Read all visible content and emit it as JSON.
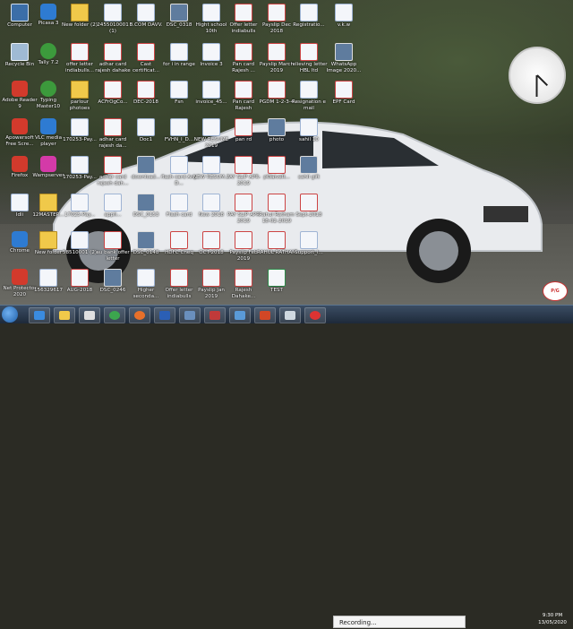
{
  "desktop": {
    "icons": [
      {
        "label": "Computer",
        "kind": "pc"
      },
      {
        "label": "Picasa 3",
        "kind": "app"
      },
      {
        "label": "New folder (2)",
        "kind": "folder"
      },
      {
        "label": "2455010001 (1)",
        "kind": "doc"
      },
      {
        "label": "B.COM DAVV.",
        "kind": "doc"
      },
      {
        "label": "DSC_0318",
        "kind": "img"
      },
      {
        "label": "Hight school 10th",
        "kind": "doc"
      },
      {
        "label": "Offer letter indiabulls",
        "kind": "pdf"
      },
      {
        "label": "Payslip Dec 2018",
        "kind": "pdf"
      },
      {
        "label": "Registratio...",
        "kind": "doc"
      },
      {
        "label": "v.k.w",
        "kind": "doc"
      },
      {
        "label": "Recycle Bin",
        "kind": "recycle"
      },
      {
        "label": "Tally 7.2",
        "kind": "green"
      },
      {
        "label": "offer letter indiabulls...",
        "kind": "pdf"
      },
      {
        "label": "adhar card rajesh dahake",
        "kind": "pdf"
      },
      {
        "label": "Cast certificat...",
        "kind": "pdf"
      },
      {
        "label": "for i in range",
        "kind": "doc"
      },
      {
        "label": "Invoice 3",
        "kind": "doc"
      },
      {
        "label": "Pan card Rajesh ...",
        "kind": "pdf"
      },
      {
        "label": "Payslip March 2019",
        "kind": "pdf"
      },
      {
        "label": "relieving letter HBL ltd",
        "kind": "pdf"
      },
      {
        "label": "WhatsApp Image 2020...",
        "kind": "img"
      },
      {
        "label": "Adobe Reader 9",
        "kind": "red"
      },
      {
        "label": "Typing Master10",
        "kind": "green"
      },
      {
        "label": "parlour photoes",
        "kind": "folder"
      },
      {
        "label": "ACFrOgCo...",
        "kind": "pdf"
      },
      {
        "label": "DEC-2018",
        "kind": "pdf"
      },
      {
        "label": "Fsn",
        "kind": "doc"
      },
      {
        "label": "invoice_45...",
        "kind": "doc"
      },
      {
        "label": "Pan card Rajesh",
        "kind": "pdf"
      },
      {
        "label": "PGDM 1-2-3-4",
        "kind": "pdf"
      },
      {
        "label": "Resignation e mail",
        "kind": "doc"
      },
      {
        "label": "EPF Card",
        "kind": "pdf"
      },
      {
        "label": "Apowersoft Free Scre...",
        "kind": "red"
      },
      {
        "label": "VLC media player",
        "kind": "app"
      },
      {
        "label": "170253-Pay...",
        "kind": "doc"
      },
      {
        "label": "adhar card rajesh da...",
        "kind": "pdf"
      },
      {
        "label": "Doc1",
        "kind": "doc"
      },
      {
        "label": "FVHN_I_D...",
        "kind": "doc"
      },
      {
        "label": "NEW RESUME 2019",
        "kind": "doc"
      },
      {
        "label": "pan rd",
        "kind": "pdf"
      },
      {
        "label": "photo",
        "kind": "img"
      },
      {
        "label": "sahil 10",
        "kind": "doc"
      },
      {
        "label": "Firefox",
        "kind": "red"
      },
      {
        "label": "Wamp­server",
        "kind": "pink"
      },
      {
        "label": "170253-Pay...",
        "kind": "doc"
      },
      {
        "label": "adhar card rajesh dah...",
        "kind": "pdf"
      },
      {
        "label": "download...",
        "kind": "img"
      },
      {
        "label": "flash card Any D...",
        "kind": "doc"
      },
      {
        "label": "NEW RESUM...",
        "kind": "doc"
      },
      {
        "label": "PAY SLIP APR-2019",
        "kind": "pdf"
      },
      {
        "label": "pWaiveR...",
        "kind": "pdf"
      },
      {
        "label": "sahil gift",
        "kind": "img"
      },
      {
        "label": "Idli",
        "kind": "doc"
      },
      {
        "label": "12MASTER...",
        "kind": "folder"
      },
      {
        "label": "17025-Pay...",
        "kind": "doc"
      },
      {
        "label": "appli...",
        "kind": "doc"
      },
      {
        "label": "DSC_0153",
        "kind": "img"
      },
      {
        "label": "Flash card",
        "kind": "doc"
      },
      {
        "label": "New 2018",
        "kind": "doc"
      },
      {
        "label": "PAY SLIP APR 2019",
        "kind": "pdf"
      },
      {
        "label": "Rahul Ratham 18-02-2019",
        "kind": "pdf"
      },
      {
        "label": "Sept-2018",
        "kind": "pdf"
      },
      {
        "label": "Chrome",
        "kind": "app"
      },
      {
        "label": "New folder",
        "kind": "folder"
      },
      {
        "label": "58510001 (2)",
        "kind": "doc"
      },
      {
        "label": "au bank offer letter",
        "kind": "pdf"
      },
      {
        "label": "DSC_0148",
        "kind": "img"
      },
      {
        "label": "HDFC Cheq",
        "kind": "pdf"
      },
      {
        "label": "OCT-2018",
        "kind": "pdf"
      },
      {
        "label": "Payslip Feb 2019",
        "kind": "pdf"
      },
      {
        "label": "RAHUL RATHAM",
        "kind": "pdf"
      },
      {
        "label": "Support_l...",
        "kind": "doc"
      },
      {
        "label": "Net Protector 2020",
        "kind": "red"
      },
      {
        "label": "156329617",
        "kind": "doc"
      },
      {
        "label": "AUG-2018",
        "kind": "pdf"
      },
      {
        "label": "DSC_0246",
        "kind": "img"
      },
      {
        "label": "Higher seconda...",
        "kind": "doc"
      },
      {
        "label": "Offer letter indiabulls",
        "kind": "pdf"
      },
      {
        "label": "Payslip Jan 2019",
        "kind": "pdf"
      },
      {
        "label": "Rajesh Dahake...",
        "kind": "pdf"
      },
      {
        "label": "TEST",
        "kind": "xls"
      }
    ]
  },
  "taskbar": {
    "recording_label": "Recording...",
    "time": "9:30 PM",
    "date": "13/05/2020"
  },
  "brand_badge": "P/G"
}
